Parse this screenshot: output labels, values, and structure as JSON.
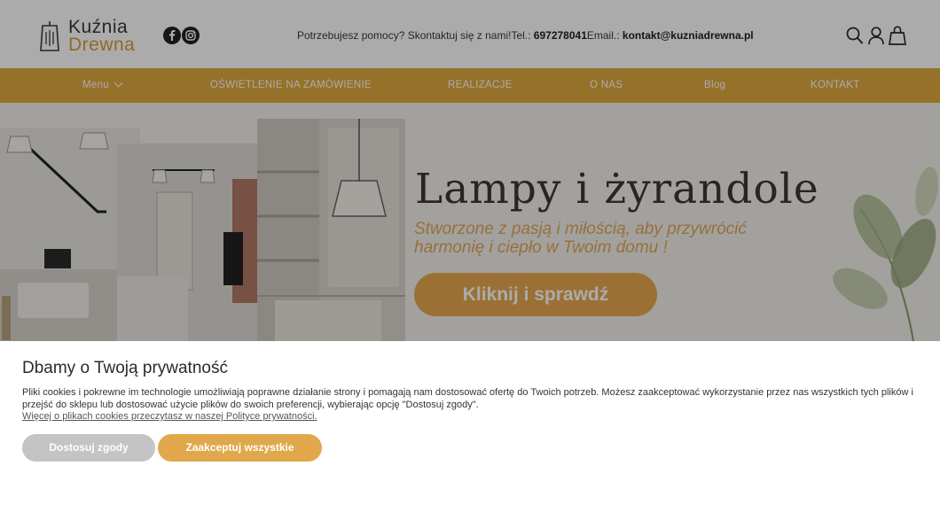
{
  "logo": {
    "line1": "Kuźnia",
    "line2": "Drewna"
  },
  "header": {
    "help_text": "Potrzebujesz pomocy? Skontaktuj się z nami!",
    "tel_label": "Tel.: ",
    "tel_value": "697278041",
    "email_label": "Email.: ",
    "email_value": "kontakt@kuzniadrewna.pl",
    "icons": [
      "facebook-icon",
      "instagram-icon",
      "search-icon",
      "user-icon",
      "bag-icon"
    ]
  },
  "nav": {
    "items": [
      "Menu",
      "OŚWIETLENIE NA ZAMÓWIENIE",
      "REALIZACJE",
      "O NAS",
      "Blog",
      "KONTAKT"
    ]
  },
  "hero": {
    "title": "Lampy i żyrandole",
    "subtitle": "Stworzone z pasją i miłością, aby przywrócić harmonię i ciepło w Twoim domu !",
    "button": "Kliknij i sprawdź"
  },
  "cookie": {
    "title": "Dbamy o Twoją prywatność",
    "text": "Pliki cookies i pokrewne im technologie umożliwiają poprawne działanie strony i pomagają nam dostosować ofertę do Twoich potrzeb. Możesz zaakceptować wykorzystanie przez nas wszystkich tych plików i przejść do sklepu lub dostosować użycie plików do swoich preferencji, wybierając opcję \"Dostosuj zgody\".",
    "link": "Więcej o plikach cookies przeczytasz w naszej Polityce prywatności.",
    "customize_button": "Dostosuj zgody",
    "accept_button": "Zaakceptuj wszystkie"
  },
  "colors": {
    "accent": "#e0a93f",
    "button_grey": "#c4c4c4",
    "accept": "#e0a84b"
  }
}
